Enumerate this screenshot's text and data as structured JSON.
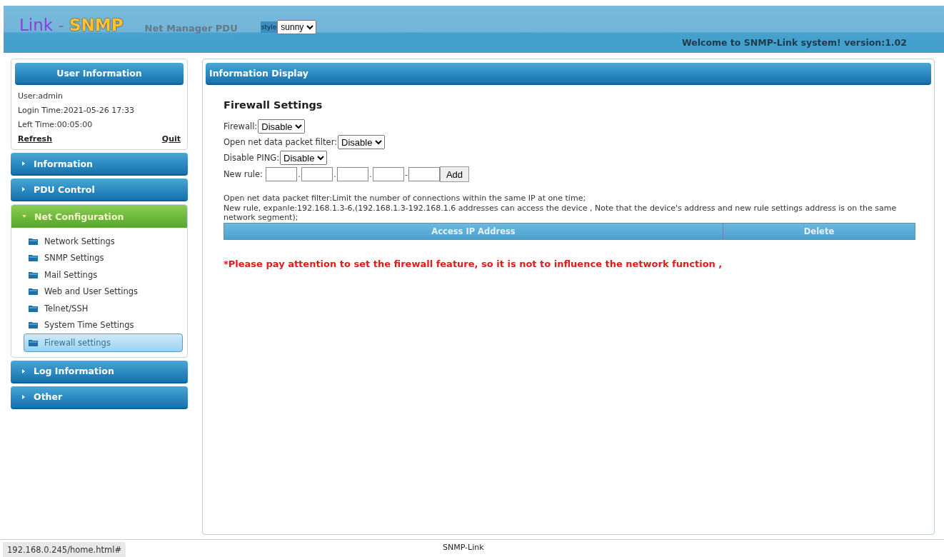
{
  "header": {
    "logo_left": "Link",
    "logo_dash": "-",
    "logo_right": "SNMP",
    "product": "Net Manager PDU",
    "style_label": "style",
    "style_select": "sunny",
    "welcome": "Welcome to SNMP-Link system! version:1.02"
  },
  "user_panel": {
    "title": "User Information",
    "lines": [
      "User:admin",
      "Login Time:2021-05-26 17:33",
      "Left Time:00:05:00"
    ],
    "refresh": "Refresh",
    "quit": "Quit"
  },
  "menu": [
    {
      "label": "Information",
      "expanded": false
    },
    {
      "label": "PDU Control",
      "expanded": false
    },
    {
      "label": "Net Configuration",
      "expanded": true,
      "children": [
        {
          "label": "Network Settings",
          "selected": false
        },
        {
          "label": "SNMP Settings",
          "selected": false
        },
        {
          "label": "Mail Settings",
          "selected": false
        },
        {
          "label": "Web and User Settings",
          "selected": false
        },
        {
          "label": "Telnet/SSH",
          "selected": false
        },
        {
          "label": "System Time Settings",
          "selected": false
        },
        {
          "label": "Firewall settings",
          "selected": true
        }
      ]
    },
    {
      "label": "Log Information",
      "expanded": false
    },
    {
      "label": "Other",
      "expanded": false
    }
  ],
  "main": {
    "title": "Information Display",
    "heading": "Firewall Settings",
    "selects": [
      {
        "label": "Firewall:",
        "value": "Disable"
      },
      {
        "label": "Open net data packet filter:",
        "value": "Disable"
      },
      {
        "label": "Disable PING:",
        "value": "Disable"
      }
    ],
    "new_rule": {
      "label": "New rule:",
      "separators": [
        ".",
        ".",
        ".",
        "-"
      ],
      "add": "Add"
    },
    "notes": [
      "Open net data packet filter:Limit the number of connections within the same IP at one time;",
      "New rule, expanle:192.168.1.3-6,(192.168.1.3-192.168.1.6 addresses can access the device , Note that the device's address and new rule settings address is on the same network segment);"
    ],
    "table": {
      "columns": [
        "Access IP Address",
        "Delete"
      ]
    },
    "warning": "*Please pay attention to set the firewall feature, so it is not to influence the network function ,"
  },
  "footer": {
    "status_url": "192.168.0.245/home.html#",
    "center": "SNMP-Link"
  }
}
